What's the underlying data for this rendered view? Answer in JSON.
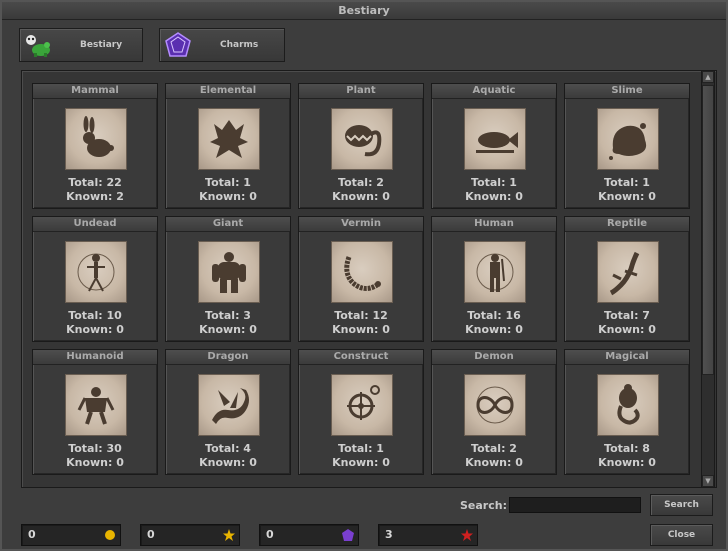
{
  "window": {
    "title": "Bestiary"
  },
  "tabs": {
    "bestiary_label": "Bestiary",
    "charms_label": "Charms"
  },
  "categories": [
    {
      "name": "Mammal",
      "total": "Total: 22",
      "known": "Known: 2",
      "icon": "rabbit-icon"
    },
    {
      "name": "Elemental",
      "total": "Total: 1",
      "known": "Known: 0",
      "icon": "elemental-icon"
    },
    {
      "name": "Plant",
      "total": "Total: 2",
      "known": "Known: 0",
      "icon": "plant-icon"
    },
    {
      "name": "Aquatic",
      "total": "Total: 1",
      "known": "Known: 0",
      "icon": "fish-icon"
    },
    {
      "name": "Slime",
      "total": "Total: 1",
      "known": "Known: 0",
      "icon": "slime-icon"
    },
    {
      "name": "Undead",
      "total": "Total: 10",
      "known": "Known: 0",
      "icon": "skeleton-icon"
    },
    {
      "name": "Giant",
      "total": "Total: 3",
      "known": "Known: 0",
      "icon": "giant-icon"
    },
    {
      "name": "Vermin",
      "total": "Total: 12",
      "known": "Known: 0",
      "icon": "centipede-icon"
    },
    {
      "name": "Human",
      "total": "Total: 16",
      "known": "Known: 0",
      "icon": "human-icon"
    },
    {
      "name": "Reptile",
      "total": "Total: 7",
      "known": "Known: 0",
      "icon": "lizard-icon"
    },
    {
      "name": "Humanoid",
      "total": "Total: 30",
      "known": "Known: 0",
      "icon": "humanoid-icon"
    },
    {
      "name": "Dragon",
      "total": "Total: 4",
      "known": "Known: 0",
      "icon": "dragon-icon"
    },
    {
      "name": "Construct",
      "total": "Total: 1",
      "known": "Known: 0",
      "icon": "gear-icon"
    },
    {
      "name": "Demon",
      "total": "Total: 2",
      "known": "Known: 0",
      "icon": "infinity-icon"
    },
    {
      "name": "Magical",
      "total": "Total: 8",
      "known": "Known: 0",
      "icon": "genie-icon"
    }
  ],
  "search": {
    "label": "Search:",
    "value": "",
    "button_label": "Search"
  },
  "currencies": [
    {
      "value": "0",
      "icon": "gold-coin-icon",
      "color": "#e8b400"
    },
    {
      "value": "0",
      "icon": "star-icon",
      "color": "#e8b400"
    },
    {
      "value": "0",
      "icon": "purple-gem-icon",
      "color": "#7a3fd0"
    },
    {
      "value": "3",
      "icon": "red-star-icon",
      "color": "#d02020"
    }
  ],
  "close_label": "Close"
}
